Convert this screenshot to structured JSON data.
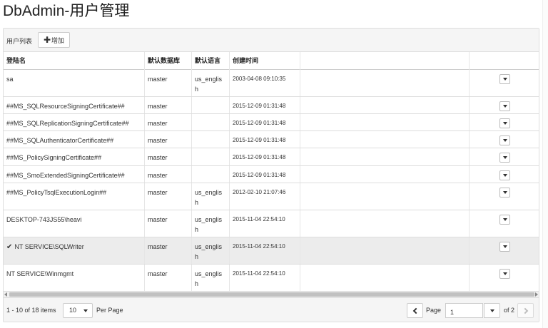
{
  "page": {
    "title": "DbAdmin-用户管理"
  },
  "toolbar": {
    "list_title": "用户列表",
    "add_label": "增加"
  },
  "columns": [
    "登陆名",
    "默认数据库",
    "默认语言",
    "创建时间",
    "",
    ""
  ],
  "rows": [
    {
      "login": "sa",
      "db": "master",
      "lang": "us_english",
      "created": "2003-04-08 09:10:35",
      "selected": false
    },
    {
      "login": "##MS_SQLResourceSigningCertificate##",
      "db": "master",
      "lang": "",
      "created": "2015-12-09 01:31:48",
      "selected": false
    },
    {
      "login": "##MS_SQLReplicationSigningCertificate##",
      "db": "master",
      "lang": "",
      "created": "2015-12-09 01:31:48",
      "selected": false
    },
    {
      "login": "##MS_SQLAuthenticatorCertificate##",
      "db": "master",
      "lang": "",
      "created": "2015-12-09 01:31:48",
      "selected": false
    },
    {
      "login": "##MS_PolicySigningCertificate##",
      "db": "master",
      "lang": "",
      "created": "2015-12-09 01:31:48",
      "selected": false
    },
    {
      "login": "##MS_SmoExtendedSigningCertificate##",
      "db": "master",
      "lang": "",
      "created": "2015-12-09 01:31:48",
      "selected": false
    },
    {
      "login": "##MS_PolicyTsqlExecutionLogin##",
      "db": "master",
      "lang": "us_english",
      "created": "2012-02-10 21:07:46",
      "selected": false
    },
    {
      "login": "DESKTOP-743JS55\\heavi",
      "db": "master",
      "lang": "us_english",
      "created": "2015-11-04 22:54:10",
      "selected": false
    },
    {
      "login": "NT SERVICE\\SQLWriter",
      "db": "master",
      "lang": "us_english",
      "created": "2015-11-04 22:54:10",
      "selected": true
    },
    {
      "login": "NT SERVICE\\Winmgmt",
      "db": "master",
      "lang": "us_english",
      "created": "2015-11-04 22:54:10",
      "selected": false
    }
  ],
  "pager": {
    "summary": "1 - 10 of 18 items",
    "page_size": "10",
    "per_page_label": "Per Page",
    "page_label": "Page",
    "current_page": "1",
    "of_pages": "of 2"
  },
  "colors": {
    "selected_row": "#ececec",
    "toolbar_bg": "#f5f5f5",
    "border": "#dddddd"
  },
  "icons": {
    "add": "plus-icon",
    "row_menu": "caret-down-icon",
    "selected": "check-icon",
    "prev": "chevron-left-icon",
    "next": "chevron-right-icon"
  }
}
